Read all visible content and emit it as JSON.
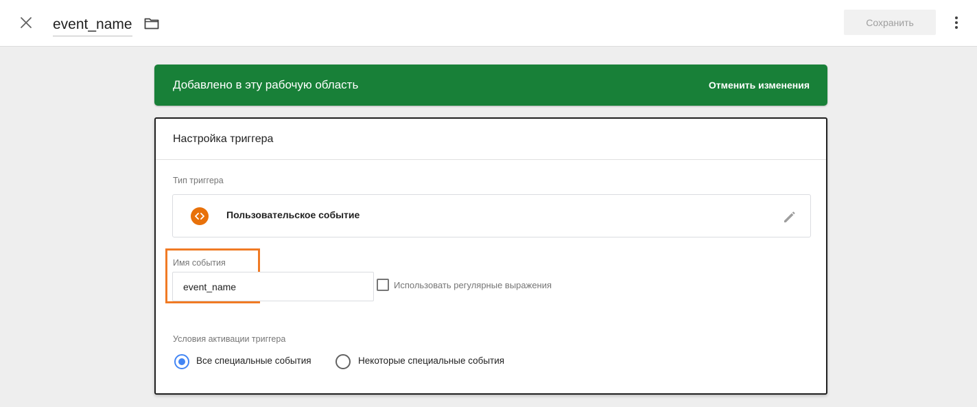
{
  "header": {
    "title": "event_name",
    "close_icon": "close-icon",
    "folder_icon": "folder-icon",
    "save_label": "Сохранить",
    "more_icon": "more-vert-icon"
  },
  "banner": {
    "text": "Добавлено в эту рабочую область",
    "action_label": "Отменить изменения",
    "color": "#188038"
  },
  "card": {
    "title": "Настройка триггера",
    "trigger_type": {
      "label": "Тип триггера",
      "value": "Пользовательское событие",
      "icon": "custom-event-icon",
      "icon_color": "#e8710a",
      "edit_icon": "pencil-icon"
    },
    "event_name": {
      "label": "Имя события",
      "value": "event_name",
      "highlight_color": "#f07a24"
    },
    "regex": {
      "label": "Использовать регулярные выражения",
      "checked": false
    },
    "firing": {
      "label": "Условия активации триггера",
      "options": [
        {
          "label": "Все специальные события",
          "selected": true
        },
        {
          "label": "Некоторые специальные события",
          "selected": false
        }
      ],
      "selected_color": "#4285f4"
    }
  }
}
